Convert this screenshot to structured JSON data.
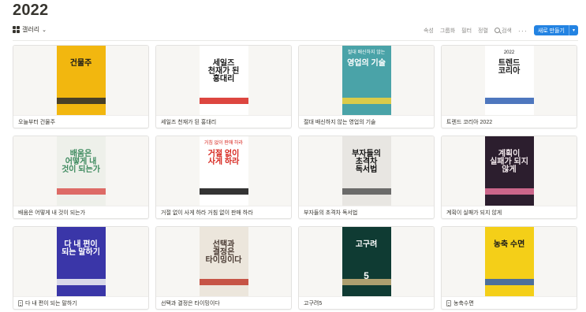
{
  "page": {
    "title": "2022"
  },
  "toolbar": {
    "view_label": "갤러리",
    "properties": "속성",
    "group": "그룹화",
    "filter": "필터",
    "sort": "정렬",
    "search": "검색",
    "more": "···",
    "new_label": "새로 만들기"
  },
  "colors": {
    "accent": "#2383e2",
    "text": "#37352f",
    "muted": "#8c8b88",
    "border": "#e3e2e0"
  },
  "cards": [
    {
      "title": "오늘부터 건물주",
      "page_icon": false,
      "cover": {
        "title": "건물주",
        "subtitle": "",
        "bg": "#f2b70f",
        "fg": "#1a1a1a",
        "accent": "#2b2b2b"
      }
    },
    {
      "title": "세일즈 천재가 된 홍대리",
      "page_icon": false,
      "cover": {
        "title": "세일즈 천재가 된 홍대리",
        "subtitle": "",
        "bg": "#ffffff",
        "fg": "#1a1a1a",
        "accent": "#d7261e"
      }
    },
    {
      "title": "절대 배신하지 않는 영업의 기술",
      "page_icon": false,
      "cover": {
        "title": "영업의 기술",
        "subtitle": "절대 배신하지 않는",
        "bg": "#4aa3a8",
        "fg": "#ffffff",
        "accent": "#f4d23a"
      }
    },
    {
      "title": "트렌드 코리아 2022",
      "page_icon": false,
      "cover": {
        "title": "트렌드 코리아",
        "subtitle": "2022",
        "bg": "#ffffff",
        "fg": "#1a1a1a",
        "accent": "#2f5fb3"
      }
    },
    {
      "title": "배움은 어떻게 내 것이 되는가",
      "page_icon": false,
      "cover": {
        "title": "배움은 어떻게 내 것이 되는가",
        "subtitle": "",
        "bg": "#eef0ea",
        "fg": "#3d8a5e",
        "accent": "#d9534f"
      }
    },
    {
      "title": "거절 없이 사게 하라 거침 없이 판매 하라",
      "page_icon": false,
      "cover": {
        "title": "거절 없이 사게 하라",
        "subtitle": "거침 없이 판매 하라",
        "bg": "#ffffff",
        "fg": "#d7261e",
        "accent": "#111111"
      }
    },
    {
      "title": "부자들의 초격차 독서법",
      "page_icon": false,
      "cover": {
        "title": "부자들의 초격차 독서법",
        "subtitle": "",
        "bg": "#e8e6e2",
        "fg": "#111111",
        "accent": "#555555"
      }
    },
    {
      "title": "계획이 실패가 되지 않게",
      "page_icon": false,
      "cover": {
        "title": "계획이 실패가 되지 않게",
        "subtitle": "",
        "bg": "#2c1e2e",
        "fg": "#f0e6ea",
        "accent": "#e8739a"
      }
    },
    {
      "title": "다 내 편이 되는 말하기",
      "page_icon": true,
      "cover": {
        "title": "다 내 편이 되는 말하기",
        "subtitle": "",
        "bg": "#3a36a8",
        "fg": "#ffffff",
        "accent": "#f4f4f4"
      }
    },
    {
      "title": "선택과 결정은 타이밍이다",
      "page_icon": false,
      "cover": {
        "title": "선택과 결정은 타이밍이다",
        "subtitle": "",
        "bg": "#ece6dc",
        "fg": "#4a3b33",
        "accent": "#c0392b"
      }
    },
    {
      "title": "고구려5",
      "page_icon": false,
      "cover": {
        "title": "고구려",
        "subtitle": "5",
        "bg": "#0f3b33",
        "fg": "#ffffff",
        "accent": "#c9b27a"
      }
    },
    {
      "title": "농축수면",
      "page_icon": true,
      "cover": {
        "title": "농축 수면",
        "subtitle": "",
        "bg": "#f4cf18",
        "fg": "#1a1a1a",
        "accent": "#2f5fb3"
      }
    }
  ]
}
